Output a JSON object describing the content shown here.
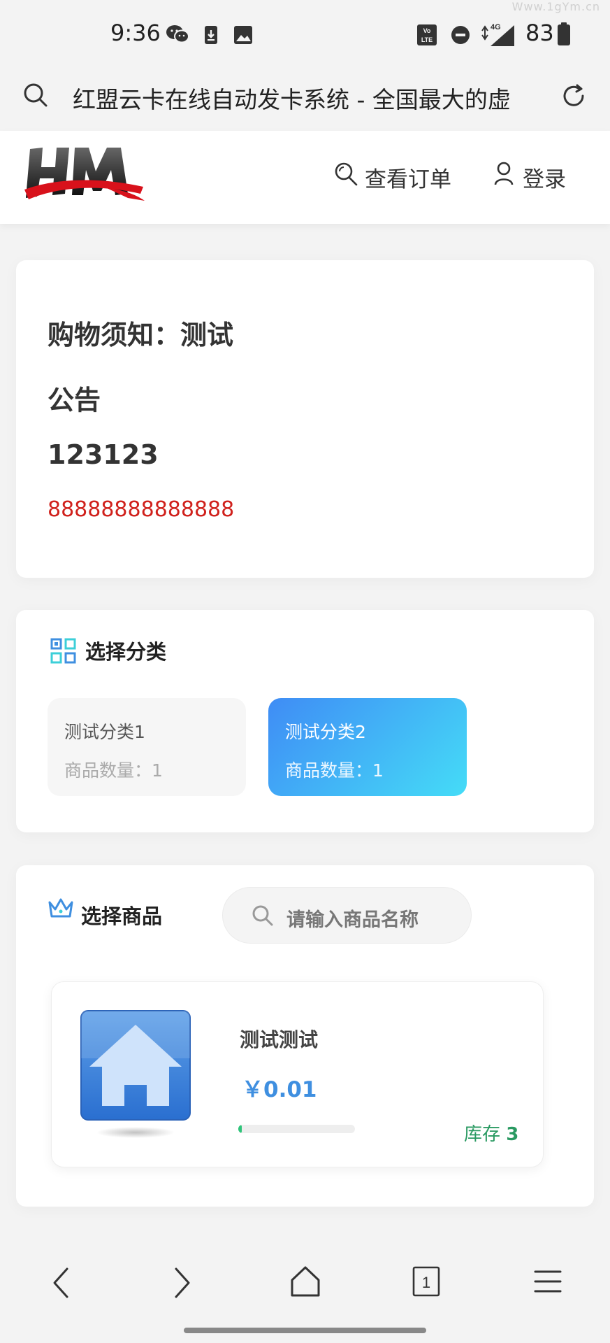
{
  "status_bar": {
    "time": "9:36",
    "network": "4G",
    "battery": "83",
    "watermark": "Www.1gYm.cn",
    "icons": [
      "wechat-icon",
      "download-icon",
      "image-icon",
      "volte-icon",
      "dnd-icon",
      "signal-icon",
      "battery-icon"
    ]
  },
  "browser": {
    "url_title": "红盟云卡在线自动发卡系统 - 全国最大的虚"
  },
  "header": {
    "logo_text": "HM",
    "nav_orders": "查看订单",
    "nav_login": "登录"
  },
  "notice": {
    "title": "购物须知：测试",
    "heading": "公告",
    "number": "123123",
    "highlight": "88888888888888"
  },
  "categories": {
    "title": "选择分类",
    "items": [
      {
        "name": "测试分类1",
        "count_label": "商品数量：1",
        "selected": false
      },
      {
        "name": "测试分类2",
        "count_label": "商品数量：1",
        "selected": true
      }
    ]
  },
  "products": {
    "title": "选择商品",
    "search_placeholder": "请输入商品名称",
    "items": [
      {
        "name": "测试测试",
        "price": "￥0.01",
        "stock_label": "库存",
        "stock_value": "3",
        "stock_fraction": 0.03
      }
    ]
  },
  "colors": {
    "accent_blue": "#3f8fe0",
    "stock_green": "#2a9a62",
    "notice_red": "#d0211c",
    "selected_gradient_start": "#3f8cf5",
    "selected_gradient_end": "#45dcf7"
  }
}
